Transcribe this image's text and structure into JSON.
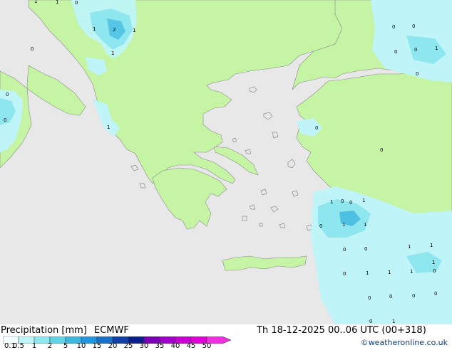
{
  "header": {
    "title": "Precipitation [mm]",
    "model": "ECMWF",
    "valid_time": "Th 18-12-2025 00..06 UTC (00+318)",
    "credit": "©weatheronline.co.uk"
  },
  "legend": {
    "tick_labels": [
      "0.1",
      "0.5",
      "1",
      "2",
      "5",
      "10",
      "15",
      "20",
      "25",
      "30",
      "35",
      "40",
      "45",
      "50"
    ],
    "colors": [
      "#f4ffff",
      "#bff4f8",
      "#8ee6ef",
      "#5fd2e6",
      "#3eb8e0",
      "#2196e0",
      "#1770c8",
      "#1040a8",
      "#0a1e8c",
      "#7a00b8",
      "#a000c8",
      "#c800d4",
      "#e000d8",
      "#f030e0"
    ]
  },
  "colors": {
    "sea": "#e8e8e8",
    "land": "#c4f4a4",
    "precip_light": "#bff4f8",
    "precip_mid": "#8ee6ef",
    "precip_strong": "#3eb8e0"
  },
  "map": {
    "region": "Balkans, Greece, Aegean Sea and western Turkey",
    "value_labels": [
      "1",
      "1",
      "0",
      "1",
      "2",
      "1",
      "1",
      "0",
      "0",
      "0",
      "1",
      "0",
      "0",
      "1",
      "0",
      "0",
      "0",
      "0",
      "0",
      "1",
      "0",
      "0",
      "1",
      "1",
      "0",
      "1",
      "0",
      "1",
      "1",
      "0",
      "1",
      "1",
      "0",
      "1",
      "1",
      "0",
      "0",
      "0",
      "0",
      "0",
      "1",
      "0"
    ]
  }
}
